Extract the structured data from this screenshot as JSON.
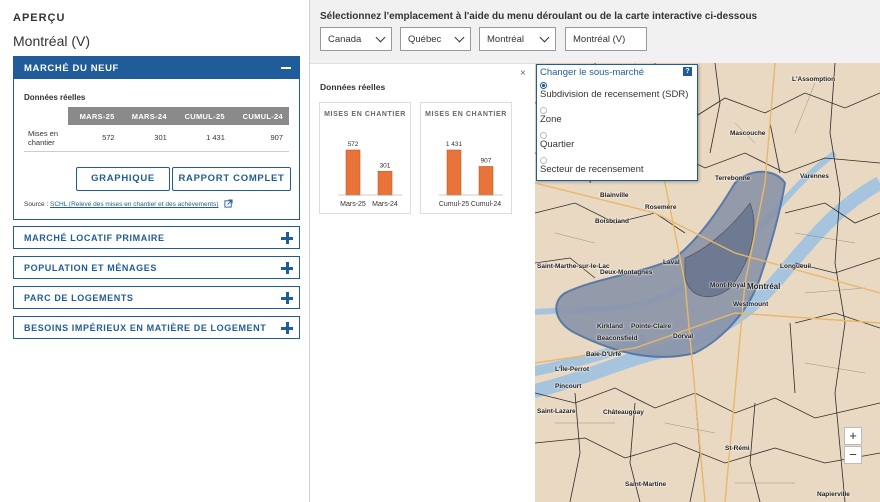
{
  "left": {
    "heading": "APERÇU",
    "place": "Montréal (V)",
    "open_section": {
      "title": "MARCHÉ DU NEUF",
      "data_label": "Données réelles",
      "columns": [
        "MARS-25",
        "MARS-24",
        "CUMUL-25",
        "CUMUL-24"
      ],
      "row_label_1": "Mises en",
      "row_label_2": "chantier",
      "values": [
        "572",
        "301",
        "1 431",
        "907"
      ],
      "button_graph": "GRAPHIQUE",
      "button_report": "RAPPORT COMPLET",
      "source_prefix": "Source : ",
      "source_link": "SCHL (Relevé des mises en chantier et des achèvements)"
    },
    "sections": [
      "MARCHÉ LOCATIF PRIMAIRE",
      "POPULATION ET MÉNAGES",
      "PARC DE LOGEMENTS",
      "BESOINS IMPÉRIEUX EN MATIÈRE DE LOGEMENT"
    ]
  },
  "right": {
    "instruction": "Sélectionnez l'emplacement à l'aide du menu déroulant ou de la carte interactive ci-dessous",
    "selects": [
      "Canada",
      "Québec",
      "Montréal",
      "Montréal (V)"
    ],
    "stats_title": "Données réelles",
    "close_symbol": "×",
    "cards": [
      {
        "title": "MISES EN CHANTIER",
        "labels": [
          "Mars-25",
          "Mars-24"
        ],
        "values": [
          572,
          301
        ],
        "value_labels": [
          "572",
          "301"
        ]
      },
      {
        "title": "MISES EN CHANTIER",
        "labels": [
          "Cumul-25",
          "Cumul-24"
        ],
        "values": [
          1431,
          907
        ],
        "value_labels": [
          "1 431",
          "907"
        ]
      }
    ],
    "bar_color": "#e8743b"
  },
  "popup": {
    "title": "Changer le sous-marché",
    "help": "?",
    "options": [
      "Subdivision de recensement (SDR)",
      "Zone",
      "Quartier",
      "Secteur de recensement"
    ],
    "selected": 0
  },
  "map": {
    "labels": [
      "L'Assomption",
      "Mascouche",
      "Terrebonne",
      "Varennes",
      "Blainville",
      "Rosemère",
      "Boisbriand",
      "Laval",
      "Longueuil",
      "Deux-Montagnes",
      "Saint-Marthe-sur-le-Lac",
      "Mont-Royal",
      "Montréal",
      "Westmount",
      "Kirkland",
      "Pointe-Claire",
      "Beaconsfield",
      "Dorval",
      "Baie-D'Urfé",
      "L'Île-Perrot",
      "Pincourt",
      "Saint-Lazare",
      "Châteauguay",
      "Saint-Martine",
      "St-Rémi",
      "Napierville"
    ],
    "zoom_in": "+",
    "zoom_out": "−"
  }
}
